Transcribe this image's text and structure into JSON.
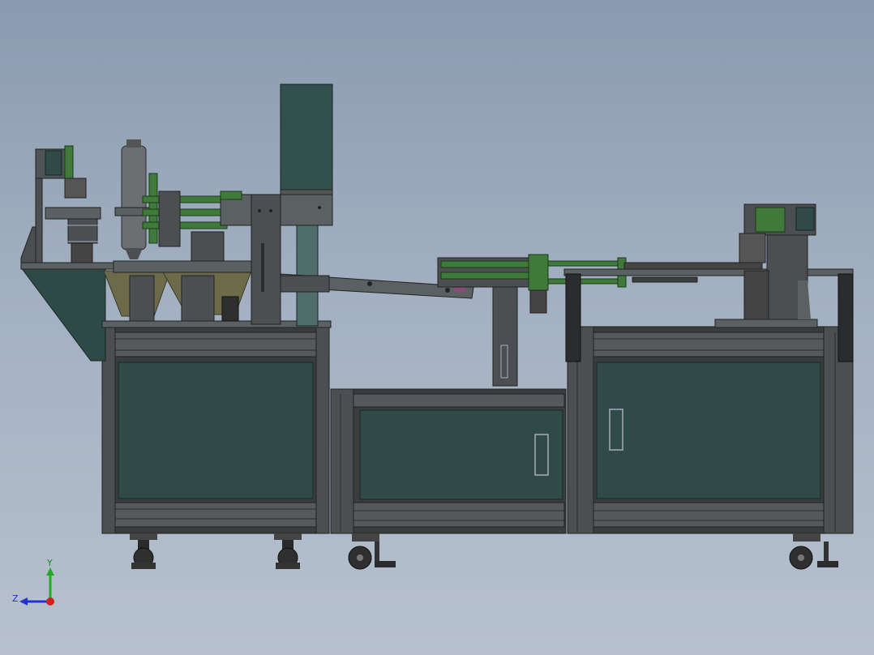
{
  "viewport": {
    "background_top": "#8a9ab0",
    "background_bottom": "#b7c1ce"
  },
  "colors": {
    "frame": "#3a3d3e",
    "frame_light": "#5b6062",
    "panel": "#2f4a47",
    "cylinder_green": "#3f7a3a",
    "motor": "#32504d",
    "hopper": "#6d6a4a",
    "casters": "#2a2a2a"
  },
  "triad": {
    "y_label": "Y",
    "z_label": "Z",
    "x_color": "#cc2222",
    "y_color": "#22aa22",
    "z_color": "#2233cc",
    "icon": "coordinate-triad-icon"
  }
}
